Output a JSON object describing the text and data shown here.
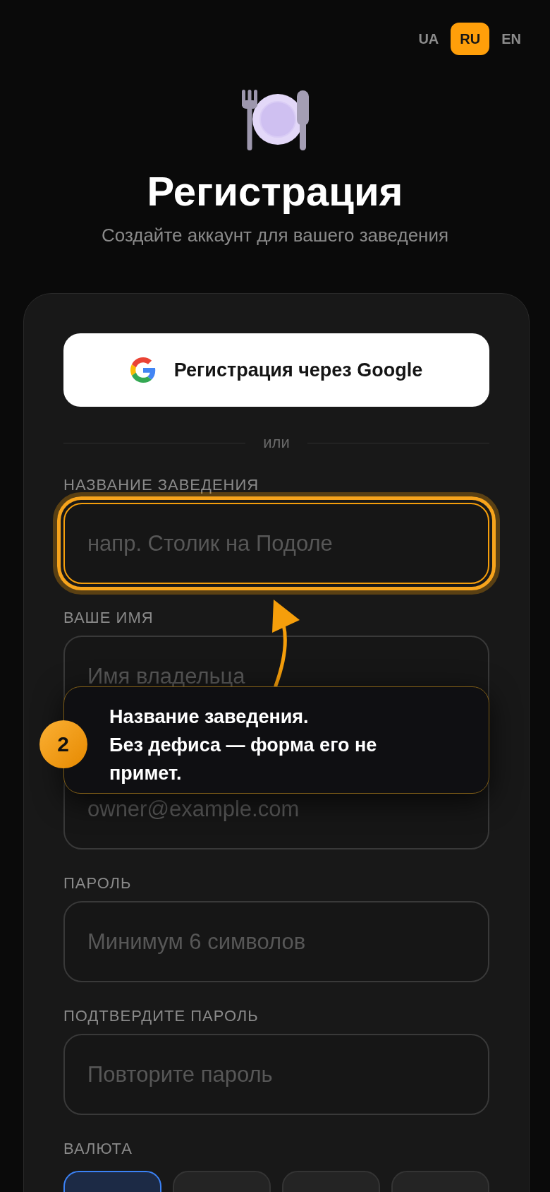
{
  "language_switch": [
    {
      "label": "UA",
      "selected": false
    },
    {
      "label": "RU",
      "selected": true
    },
    {
      "label": "EN",
      "selected": false
    }
  ],
  "header": {
    "title": "Регистрация",
    "subtitle": "Создайте аккаунт для вашего заведения"
  },
  "google_button": {
    "label": "Регистрация через Google"
  },
  "divider": {
    "label": "или"
  },
  "fields": [
    {
      "label": "НАЗВАНИЕ ЗАВЕДЕНИЯ",
      "placeholder": "напр. Столик на Подоле",
      "highlighted": true
    },
    {
      "label": "ВАШЕ ИМЯ",
      "placeholder": "Имя владельца",
      "highlighted": false
    },
    {
      "placeholder": "owner@example.com",
      "highlighted": false
    },
    {
      "label": "ПАРОЛЬ",
      "placeholder": "Минимум 6 символов",
      "highlighted": false
    },
    {
      "label": "ПОДТВЕРДИТЕ ПАРОЛЬ",
      "placeholder": "Повторите пароль",
      "highlighted": false
    }
  ],
  "currency": {
    "label": "ВАЛЮТА",
    "options": [
      {
        "selected": true
      },
      {
        "selected": false
      },
      {
        "selected": false
      },
      {
        "selected": false
      }
    ]
  },
  "tour_tip": {
    "step": "2",
    "title": "Название заведения.",
    "text": "Без дефиса — форма его не примет."
  }
}
